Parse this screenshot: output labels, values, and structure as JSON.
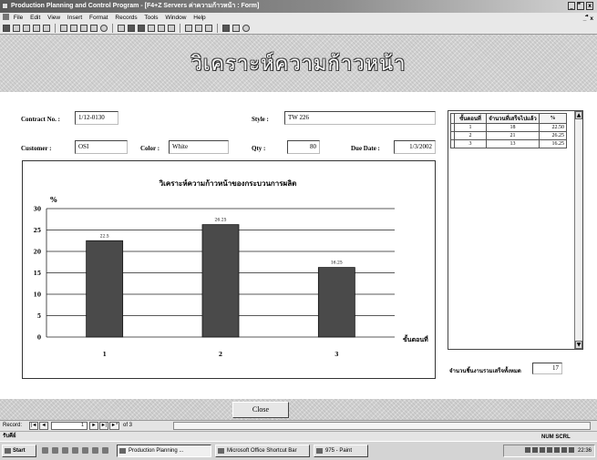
{
  "window": {
    "title": "Production Planning and Control Program - [F4+Z Servers ค่าความก้าวหน้า : Form]",
    "controls": [
      "_",
      "ื",
      "x"
    ]
  },
  "menu": {
    "items": [
      "File",
      "Edit",
      "View",
      "Insert",
      "Format",
      "Records",
      "Tools",
      "Window",
      "Help"
    ],
    "doc_controls": "_ ื x"
  },
  "header": {
    "title": "วิเคราะห์ความก้าวหน้า"
  },
  "form": {
    "contract_label": "Contract No. :",
    "contract_value": "1/12-0130",
    "style_label": "Style :",
    "style_value": "TW 226",
    "customer_label": "Customer :",
    "customer_value": "OSI",
    "color_label": "Color :",
    "color_value": "White",
    "qty_label": "Qty :",
    "qty_value": "80",
    "due_label": "Due Date :",
    "due_value": "1/3/2002"
  },
  "grid": {
    "headers": [
      "ขั้นตอนที่",
      "จำนวนที่เสร็จไปแล้ว",
      "%"
    ],
    "rows": [
      [
        "1",
        "18",
        "22.50"
      ],
      [
        "2",
        "21",
        "26.25"
      ],
      [
        "3",
        "13",
        "16.25"
      ]
    ],
    "total_label": "จำนวนชิ้นงานรวมเสร็จทั้งหมด",
    "total_value": "17"
  },
  "chart_data": {
    "type": "bar",
    "title": "วิเคราะห์ความก้าวหน้าของกระบวนการผลิต",
    "ylabel": "%",
    "xlabel": "ขั้นตอนที่",
    "categories": [
      "1",
      "2",
      "3"
    ],
    "values": [
      22.5,
      26.25,
      16.25
    ],
    "data_labels": [
      "22.5",
      "26.25",
      "16.25"
    ],
    "ylim": [
      0,
      30
    ],
    "yticks": [
      "0",
      "5",
      "10",
      "15",
      "20",
      "25",
      "30"
    ],
    "grid": true,
    "legend": "none",
    "bar_color": "#4a4a4a"
  },
  "footer": {
    "close_label": "Close"
  },
  "record_nav": {
    "label": "Record:",
    "current": "1",
    "of_text": "of 3",
    "buttons": [
      "|◄",
      "◄",
      "►",
      "►|",
      "►*"
    ]
  },
  "status": {
    "text": "รับคีย์",
    "indicator": "NUM SCRL"
  },
  "taskbar": {
    "start": "Start",
    "tasks": [
      "Production Planning ...",
      "Microsoft Office Shortcut Bar",
      "975 - Paint"
    ],
    "clock": "22:36"
  }
}
